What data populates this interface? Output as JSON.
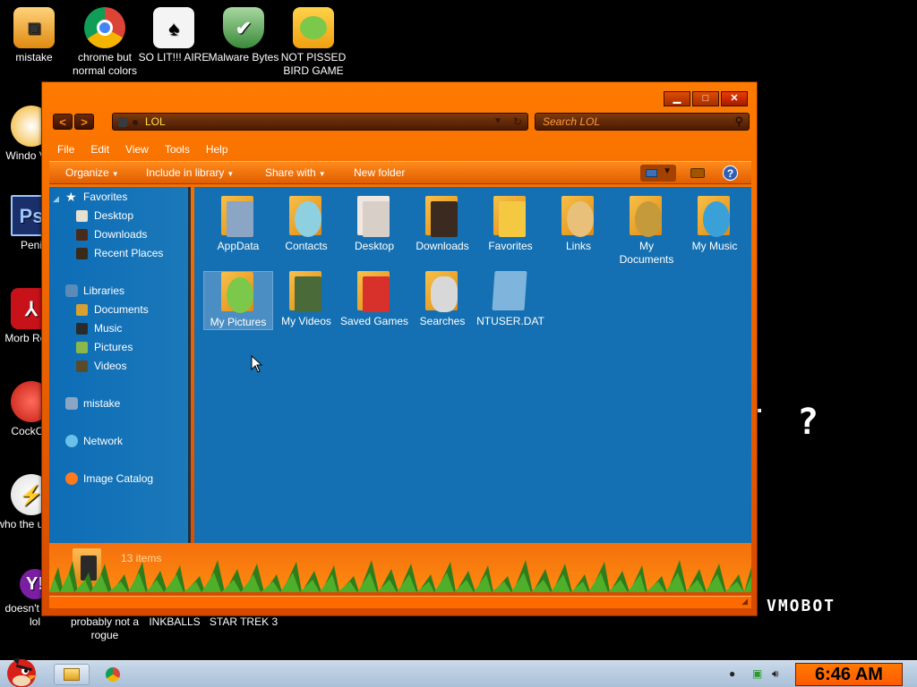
{
  "desktop": {
    "icons_top": [
      {
        "label": "mistake"
      },
      {
        "label": "chrome but normal colors"
      },
      {
        "label": "SO LIT!!! AIRE"
      },
      {
        "label": "Malware Bytes"
      },
      {
        "label": "NOT PISSED BIRD GAME"
      }
    ],
    "icons_left": [
      {
        "label": "Windo Vist"
      },
      {
        "label": "Peni"
      },
      {
        "label": "Morb Read"
      },
      {
        "label": "CockCle"
      },
      {
        "label": "who the uses t"
      },
      {
        "label": "doesn't work lol"
      }
    ],
    "icons_bottom": [
      {
        "label": "probably not a rogue"
      },
      {
        "label": "INKBALLS"
      },
      {
        "label": "STAR TREK 3"
      }
    ],
    "question_mark": "?",
    "vmobot_text": "VMOBOT"
  },
  "window": {
    "caption_buttons": {
      "minimize": "▁",
      "maximize": "□",
      "close": "✕"
    },
    "address": {
      "path": "LOL"
    },
    "search": {
      "placeholder": "Search LOL"
    },
    "menu": [
      "File",
      "Edit",
      "View",
      "Tools",
      "Help"
    ],
    "toolbar": {
      "organize": "Organize",
      "include": "Include in library",
      "share": "Share with",
      "new_folder": "New folder"
    },
    "nav": {
      "favorites": "Favorites",
      "favorites_items": [
        "Desktop",
        "Downloads",
        "Recent Places"
      ],
      "libraries": "Libraries",
      "libraries_items": [
        "Documents",
        "Music",
        "Pictures",
        "Videos"
      ],
      "user": "mistake",
      "network": "Network",
      "catalog": "Image Catalog"
    },
    "items": [
      {
        "name": "AppData",
        "color": "#8aa6c4"
      },
      {
        "name": "Contacts",
        "color": "#8fd0e0"
      },
      {
        "name": "Desktop",
        "color": "#f0e8e0"
      },
      {
        "name": "Downloads",
        "color": "#3a2a20"
      },
      {
        "name": "Favorites",
        "color": "#f5c842"
      },
      {
        "name": "Links",
        "color": "#e8c07a"
      },
      {
        "name": "My Documents",
        "color": "#c49a3a"
      },
      {
        "name": "My Music",
        "color": "#3aa0d8"
      },
      {
        "name": "My Pictures",
        "color": "#7cc84a"
      },
      {
        "name": "My Videos",
        "color": "#4a6a3a"
      },
      {
        "name": "Saved Games",
        "color": "#d8302a"
      },
      {
        "name": "Searches",
        "color": "#d8d8d8"
      },
      {
        "name": "NTUSER.DAT",
        "color": "#7fb4dc"
      }
    ],
    "status": "13 items"
  },
  "taskbar": {
    "clock": "6:46 AM"
  }
}
